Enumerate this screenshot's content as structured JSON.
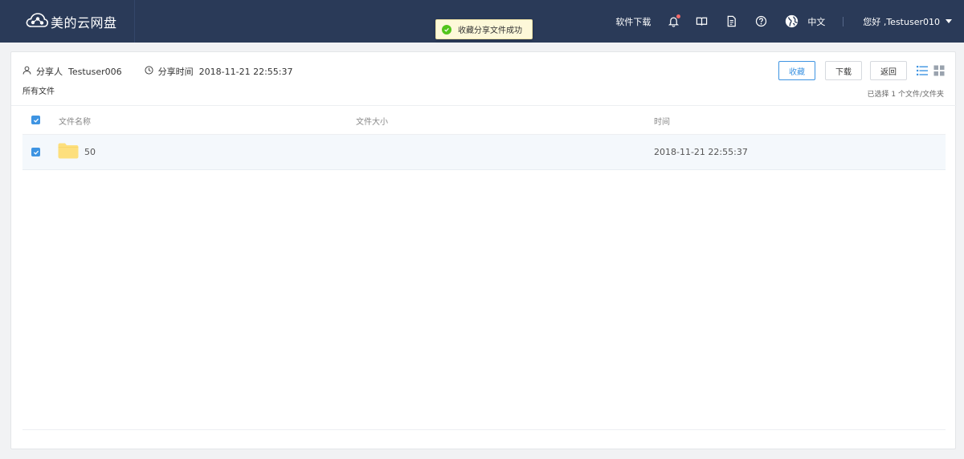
{
  "app": {
    "logo_text": "美的云网盘"
  },
  "topnav": {
    "download_software": "软件下载",
    "language": "中文",
    "greeting": "您好 ,Testuser010"
  },
  "toast": {
    "message": "收藏分享文件成功"
  },
  "share": {
    "sharer_label": "分享人",
    "sharer_value": "Testuser006",
    "time_label": "分享时间",
    "time_value": "2018-11-21 22:55:37",
    "breadcrumb": "所有文件"
  },
  "actions": {
    "favorite": "收藏",
    "download": "下载",
    "back": "返回",
    "selected_info": "已选择 1 个文件/文件夹"
  },
  "table": {
    "columns": {
      "name": "文件名称",
      "size": "文件大小",
      "time": "时间"
    },
    "rows": [
      {
        "name": "50",
        "size": "",
        "time": "2018-11-21 22:55:37",
        "checked": true,
        "type": "folder"
      }
    ]
  },
  "colors": {
    "topbar": "#2a3a58",
    "accent": "#3e94e2",
    "toast_bg": "#fdf8d9",
    "success": "#52c41a",
    "folder": "#fddf7d"
  },
  "icons": [
    "cloud-logo-icon",
    "bell-icon",
    "book-icon",
    "document-icon",
    "help-icon",
    "globe-icon",
    "user-icon",
    "clock-icon",
    "list-view-icon",
    "grid-view-icon",
    "folder-icon",
    "check-icon"
  ]
}
